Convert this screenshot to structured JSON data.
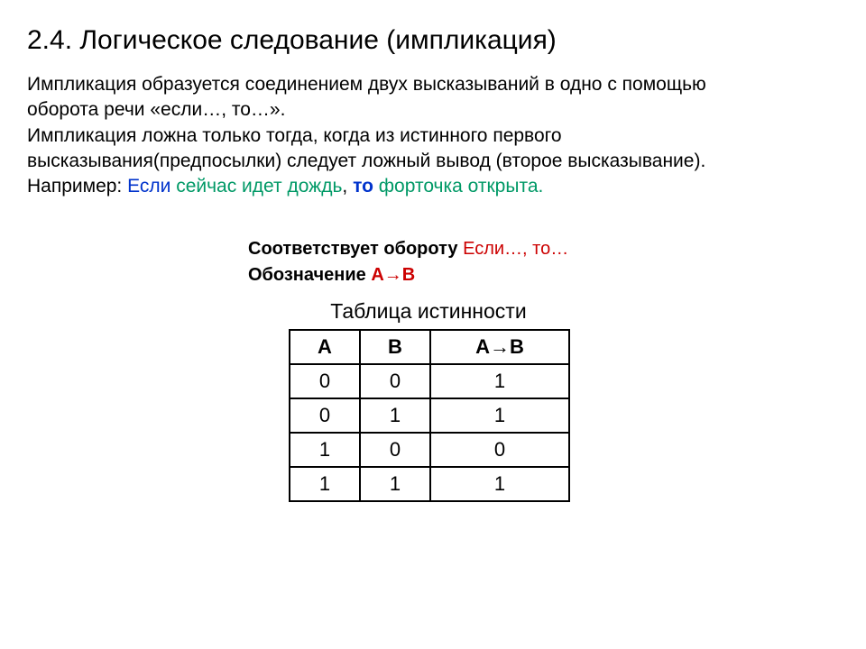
{
  "title": "2.4. Логическое следование (импликация)",
  "para1_line1": "Импликация образуется соединением двух высказываний в одно с помощью",
  "para1_line2": "оборота речи «если…, то…».",
  "para1_line3": "Импликация ложна только тогда, когда из истинного первого",
  "para1_line4": "высказывания(предпосылки)  следует ложный вывод (второе высказывание).",
  "example_prefix": "Например: ",
  "example_if": "Если ",
  "example_cond": "сейчас идет дождь",
  "example_comma": ", ",
  "example_then": "то ",
  "example_res": "форточка открыта",
  "example_period": ".",
  "corr_label": "Соответствует обороту  ",
  "corr_phrase": "Если…, то…",
  "notation_label": "Обозначение ",
  "notation_value": "А→В",
  "table_title": "Таблица истинности",
  "header_a": "А",
  "header_b": "В",
  "header_ab": "А→В",
  "chart_data": {
    "type": "table",
    "columns": [
      "А",
      "В",
      "А→В"
    ],
    "rows": [
      [
        "0",
        "0",
        "1"
      ],
      [
        "0",
        "1",
        "1"
      ],
      [
        "1",
        "0",
        "0"
      ],
      [
        "1",
        "1",
        "1"
      ]
    ]
  }
}
